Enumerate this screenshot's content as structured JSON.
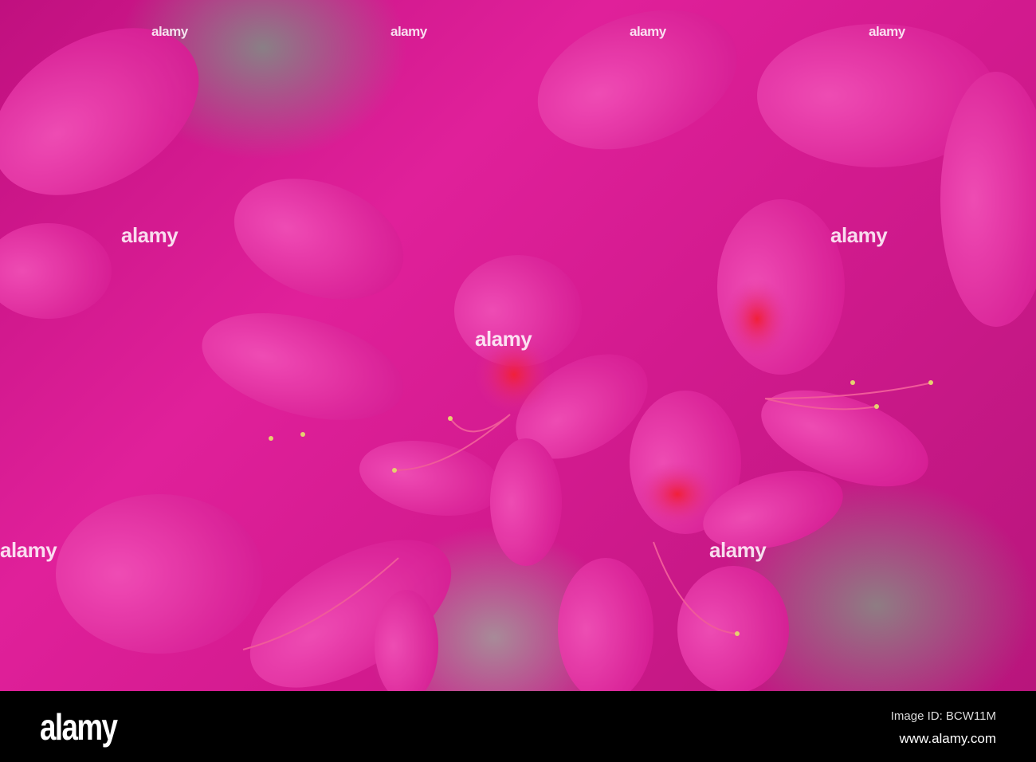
{
  "photo": {
    "subject": "pink azalea flowers",
    "colors": {
      "petal": "#e83aaa",
      "petal_dark": "#c0107f",
      "background": "#8a7f86"
    }
  },
  "watermark": "alamy",
  "footer": {
    "logo": "alamy",
    "image_id": "Image ID: BCW11M",
    "url": "www.alamy.com"
  }
}
